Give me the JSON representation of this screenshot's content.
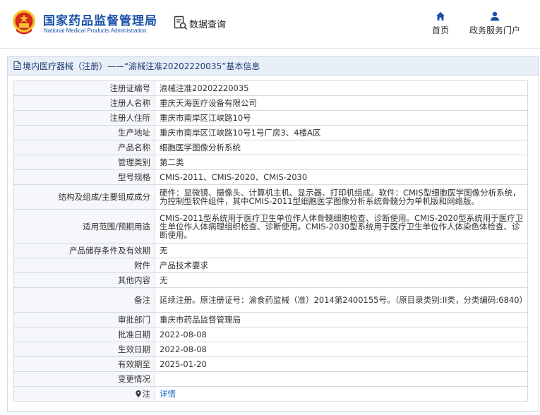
{
  "header": {
    "title_cn": "国家药品监督管理局",
    "title_en": "National Medical Products Administration",
    "query_label": "数据查询",
    "nav": [
      {
        "label": "首页",
        "icon": "home-icon"
      },
      {
        "label": "政务服务门户",
        "icon": "user-icon"
      }
    ]
  },
  "colors": {
    "brand_blue": "#1a52a8",
    "emblem_red": "#d7261e",
    "emblem_gold": "#f2c12e",
    "link_blue": "#1a6ec8",
    "panel_header_bg": "#e9eff6"
  },
  "panel": {
    "title": "境内医疗器械（注册）——“渝械注准20202220035”基本信息",
    "icon": "document-icon"
  },
  "fields": [
    {
      "label": "注册证编号",
      "value": "渝械注准20202220035"
    },
    {
      "label": "注册人名称",
      "value": "重庆天海医疗设备有限公司"
    },
    {
      "label": "注册人住所",
      "value": "重庆市南岸区江峡路10号"
    },
    {
      "label": "生产地址",
      "value": "重庆市南岸区江峡路10号1号厂房3、4楼A区"
    },
    {
      "label": "产品名称",
      "value": "细胞医学图像分析系统"
    },
    {
      "label": "管理类别",
      "value": "第二类"
    },
    {
      "label": "型号规格",
      "value": "CMIS-2011、CMIS-2020、CMIS-2030"
    },
    {
      "label": "结构及组成/主要组成成分",
      "value": "硬件：显微镜、摄像头、计算机主机、显示器、打印机组成。软件：CMIS型细胞医学图像分析系统，为控制型软件组件，其中CMIS-2011型细胞医学图像分析系统骨髓分为单机版和网络版。"
    },
    {
      "label": "适用范围/预期用途",
      "value": "CMIS-2011型系统用于医疗卫生单位作人体骨髓细胞检查、诊断使用。CMIS-2020型系统用于医疗卫生单位作人体病理组织检查、诊断使用。CMIS-2030型系统用于医疗卫生单位作人体染色体检查、诊断使用。"
    },
    {
      "label": "产品储存条件及有效期",
      "value": "无"
    },
    {
      "label": "附件",
      "value": "产品技术要求"
    },
    {
      "label": "其他内容",
      "value": "无"
    },
    {
      "label": "备注",
      "value": "延续注册。原注册证号：渝食药监械（准）2014第2400155号。（原目录类别:II类，分类编码:6840）"
    },
    {
      "label": "审批部门",
      "value": "重庆市药品监督管理局"
    },
    {
      "label": "批准日期",
      "value": "2022-08-08"
    },
    {
      "label": "生效日期",
      "value": "2022-08-08"
    },
    {
      "label": "有效期至",
      "value": "2025-01-20"
    },
    {
      "label": "变更情况",
      "value": ""
    },
    {
      "label": "注",
      "value": "详情",
      "icon": "pin-icon"
    }
  ]
}
